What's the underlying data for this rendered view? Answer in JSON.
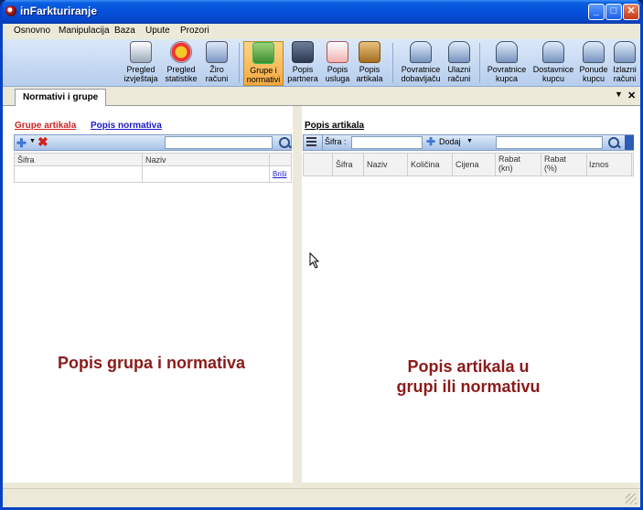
{
  "window": {
    "title": "inFarkturiranje"
  },
  "menu": [
    "Osnovno",
    "Manipulacija",
    "Baza",
    "Upute",
    "Prozori"
  ],
  "toolbar": [
    {
      "line1": "Pregled",
      "line2": "izvještaja",
      "icon": "report-icon"
    },
    {
      "line1": "Pregled",
      "line2": "statistike",
      "icon": "pie-chart-icon"
    },
    {
      "line1": "Žiro",
      "line2": "računi",
      "icon": "calculator-icon"
    },
    {
      "line1": "Grupe i",
      "line2": "normativi",
      "icon": "groups-icon"
    },
    {
      "line1": "Popis",
      "line2": "partnera",
      "icon": "partners-icon"
    },
    {
      "line1": "Popis",
      "line2": "usluga",
      "icon": "services-icon"
    },
    {
      "line1": "Popis",
      "line2": "artikala",
      "icon": "box-icon"
    },
    {
      "line1": "Povratnice",
      "line2": "dobavljaču",
      "icon": "printer-icon"
    },
    {
      "line1": "Ulazni",
      "line2": "računi",
      "icon": "printer-icon"
    },
    {
      "line1": "Povratnice",
      "line2": "kupca",
      "icon": "printer-icon"
    },
    {
      "line1": "Dostavnice",
      "line2": "kupcu",
      "icon": "printer-icon"
    },
    {
      "line1": "Ponude",
      "line2": "kupcu",
      "icon": "printer-icon"
    },
    {
      "line1": "Izlazni",
      "line2": "računi",
      "icon": "printer-icon"
    }
  ],
  "tab": {
    "label": "Normativi i grupe"
  },
  "left": {
    "link_groups": "Grupe artikala",
    "link_normatives": "Popis normativa",
    "columns": [
      "Šifra",
      "Naziv"
    ],
    "delete_link": "Briši",
    "big_label": "Popis grupa i normativa"
  },
  "right": {
    "heading": "Popis artikala",
    "sifra_label": "Šifra :",
    "add_label": "Dodaj",
    "columns": [
      "Šifra",
      "Naziv",
      "Količina",
      "Cijena",
      "Rabat (kn)",
      "Rabat (%)",
      "Iznos"
    ],
    "big_label_line1": "Popis artikala u",
    "big_label_line2": "grupi ili normativu"
  },
  "colors": {
    "link_active": "#cc2222",
    "link": "#1a1acc",
    "big_label": "#8b1a1a"
  }
}
